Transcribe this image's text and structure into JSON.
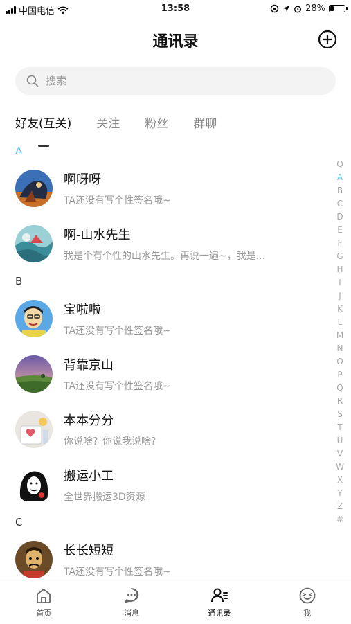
{
  "status_bar": {
    "carrier": "中国电信",
    "time": "13:58",
    "battery": "28%",
    "battery_level": 0.28
  },
  "header": {
    "title": "通讯录",
    "add_icon": "plus-circle-icon"
  },
  "search": {
    "placeholder": "搜索",
    "icon": "search-icon"
  },
  "tabs": [
    {
      "label": "好友(互关)",
      "active": true
    },
    {
      "label": "关注",
      "active": false
    },
    {
      "label": "粉丝",
      "active": false
    },
    {
      "label": "群聊",
      "active": false
    }
  ],
  "sections": [
    {
      "letter": "A",
      "contacts": [
        {
          "name": "啊呀呀",
          "signature": "TA还没有写个性签名哦~"
        },
        {
          "name": "啊-山水先生",
          "signature": "我是个有个性的山水先生。再说一遍~，我是..."
        }
      ]
    },
    {
      "letter": "B",
      "contacts": [
        {
          "name": "宝啦啦",
          "signature": "TA还没有写个性签名哦~"
        },
        {
          "name": "背靠京山",
          "signature": "TA还没有写个性签名哦~"
        },
        {
          "name": "本本分分",
          "signature": "你说啥？你说我说啥？"
        },
        {
          "name": "搬运小工",
          "signature": "全世界搬运3D资源"
        }
      ]
    },
    {
      "letter": "C",
      "contacts": [
        {
          "name": "长长短短",
          "signature": "TA还没有写个性签名哦~"
        }
      ]
    }
  ],
  "index_letters": [
    "Q",
    "A",
    "B",
    "C",
    "D",
    "E",
    "F",
    "G",
    "H",
    "I",
    "J",
    "K",
    "L",
    "M",
    "N",
    "O",
    "P",
    "Q",
    "R",
    "S",
    "T",
    "U",
    "V",
    "W",
    "X",
    "Y",
    "Z",
    "#"
  ],
  "bottom_nav": [
    {
      "label": "首页",
      "icon": "home-icon",
      "active": false
    },
    {
      "label": "消息",
      "icon": "message-icon",
      "active": false
    },
    {
      "label": "通讯录",
      "icon": "contacts-icon",
      "active": true
    },
    {
      "label": "我",
      "icon": "smiley-icon",
      "active": false
    }
  ],
  "colors": {
    "accent": "#5ccbea",
    "text_primary": "#111111",
    "text_secondary": "#9a9a9a",
    "search_bg": "#f3f3f3"
  }
}
